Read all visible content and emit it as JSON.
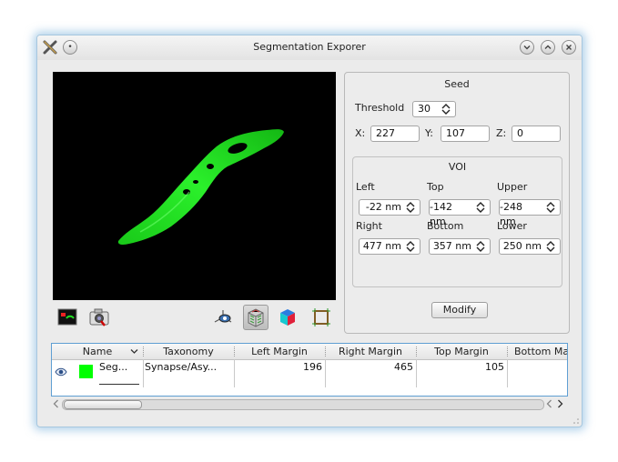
{
  "window": {
    "title": "Segmentation Exporer"
  },
  "seed": {
    "title": "Seed",
    "threshold_label": "Threshold",
    "threshold_value": "30",
    "x_label": "X:",
    "x_value": "227",
    "y_label": "Y:",
    "y_value": "107",
    "z_label": "Z:",
    "z_value": "0"
  },
  "voi": {
    "title": "VOI",
    "left_label": "Left",
    "left_value": "-22 nm",
    "top_label": "Top",
    "top_value": "-142 nm",
    "upper_label": "Upper",
    "upper_value": "-248 nm",
    "right_label": "Right",
    "right_value": "477 nm",
    "bottom_label": "Bottom",
    "bottom_value": "357 nm",
    "lower_label": "Lower",
    "lower_value": "250 nm",
    "modify_label": "Modify"
  },
  "table": {
    "columns": [
      "Name",
      "Taxonomy",
      "Left Margin",
      "Right Margin",
      "Top Margin",
      "Bottom Ma"
    ],
    "row": {
      "name": "Seg...",
      "taxonomy": "Synapse/Asy...",
      "left_margin": "196",
      "right_margin": "465",
      "top_margin": "105",
      "bottom_margin": "",
      "color": "#00ff00"
    }
  },
  "colors": {
    "segmentation": "#1fdc1f",
    "accent": "#5f9fd3"
  },
  "icons": [
    "app-x-icon",
    "pin-icon",
    "minimize-icon",
    "maximize-icon",
    "close-icon",
    "render-view-icon",
    "snapshot-camera-icon",
    "reset-camera-icon",
    "volume-render-icon",
    "cube-render-icon",
    "bounding-box-icon",
    "visibility-eye-icon"
  ]
}
